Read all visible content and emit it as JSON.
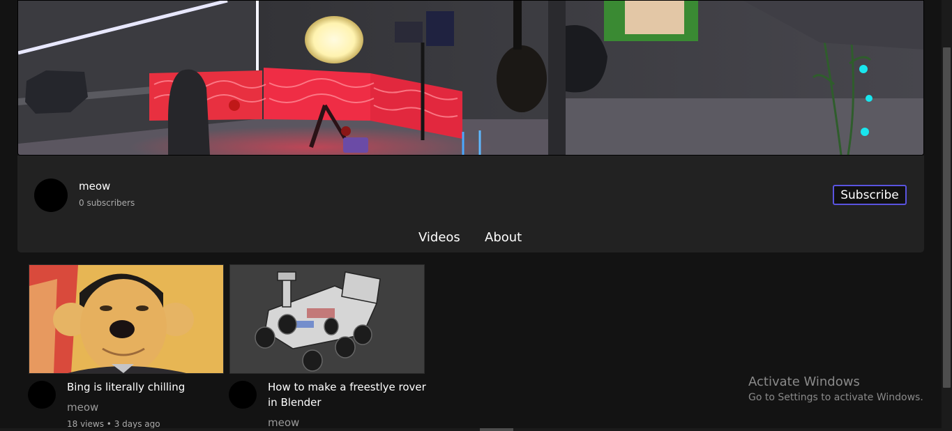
{
  "banner": {
    "icon": "gaming-room-banner"
  },
  "channel": {
    "name": "meow",
    "subscribers": "0 subscribers",
    "subscribe_label": "Subscribe"
  },
  "tabs": [
    {
      "label": "Videos"
    },
    {
      "label": "About"
    }
  ],
  "videos": [
    {
      "title": "Bing is literally chilling",
      "channel": "meow",
      "views": "18 views",
      "age": "3 days ago",
      "thumbnail_icon": "bear-face-thumbnail"
    },
    {
      "title": "How to make a freestlye rover in Blender",
      "channel": "meow",
      "thumbnail_icon": "rover-model-thumbnail"
    }
  ],
  "activation": {
    "title": "Activate Windows",
    "subtitle": "Go to Settings to activate Windows."
  },
  "colors": {
    "page_bg": "#131313",
    "card_bg": "#222222",
    "subscribe_border": "#5a54e0",
    "muted_text": "#aaaaaa"
  }
}
